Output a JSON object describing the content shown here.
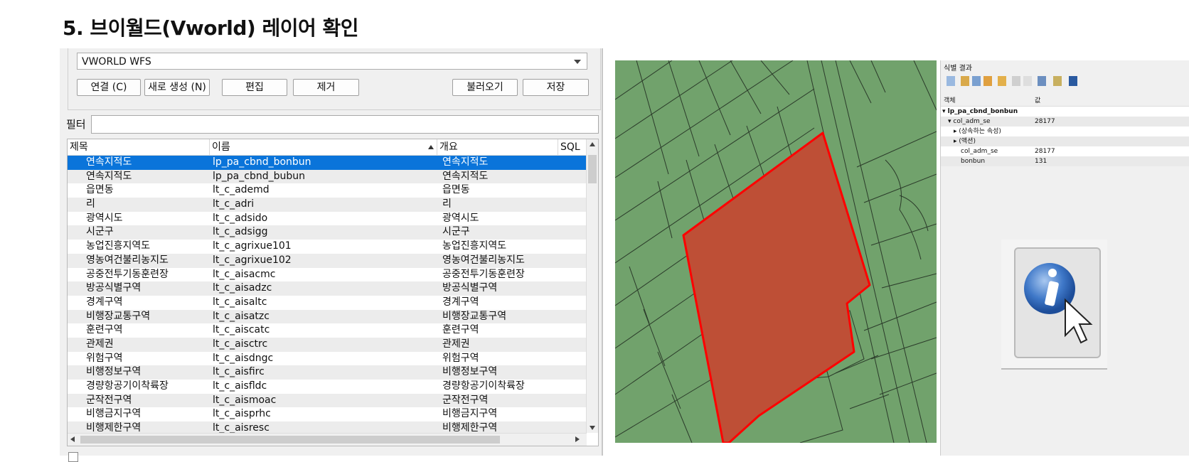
{
  "page_title": "5. 브이월드(Vworld) 레이어 확인",
  "connection": {
    "selected": "VWORLD WFS",
    "buttons": {
      "connect": "연결 (C)",
      "new": "새로 생성 (N)",
      "edit": "편집",
      "remove": "제거",
      "load": "불러오기",
      "save": "저장"
    }
  },
  "filter": {
    "label": "필터",
    "value": ""
  },
  "table": {
    "headers": [
      "제목",
      "이름",
      "개요",
      "SQL"
    ],
    "rows": [
      [
        "연속지적도",
        "lp_pa_cbnd_bonbun",
        "연속지적도"
      ],
      [
        "연속지적도",
        "lp_pa_cbnd_bubun",
        "연속지적도"
      ],
      [
        "읍면동",
        "lt_c_ademd",
        "읍면동"
      ],
      [
        "리",
        "lt_c_adri",
        "리"
      ],
      [
        "광역시도",
        "lt_c_adsido",
        "광역시도"
      ],
      [
        "시군구",
        "lt_c_adsigg",
        "시군구"
      ],
      [
        "농업진흥지역도",
        "lt_c_agrixue101",
        "농업진흥지역도"
      ],
      [
        "영농여건불리농지도",
        "lt_c_agrixue102",
        "영농여건불리농지도"
      ],
      [
        "공중전투기동훈련장",
        "lt_c_aisacmc",
        "공중전투기동훈련장"
      ],
      [
        "방공식별구역",
        "lt_c_aisadzc",
        "방공식별구역"
      ],
      [
        "경계구역",
        "lt_c_aisaltc",
        "경계구역"
      ],
      [
        "비행장교통구역",
        "lt_c_aisatzc",
        "비행장교통구역"
      ],
      [
        "훈련구역",
        "lt_c_aiscatc",
        "훈련구역"
      ],
      [
        "관제권",
        "lt_c_aisctrc",
        "관제권"
      ],
      [
        "위험구역",
        "lt_c_aisdngc",
        "위험구역"
      ],
      [
        "비행정보구역",
        "lt_c_aisfirc",
        "비행정보구역"
      ],
      [
        "경량항공기이착륙장",
        "lt_c_aisfldc",
        "경량항공기이착륙장"
      ],
      [
        "군작전구역",
        "lt_c_aismoac",
        "군작전구역"
      ],
      [
        "비행금지구역",
        "lt_c_aisprhc",
        "비행금지구역"
      ],
      [
        "비행제한구역",
        "lt_c_aisresc",
        "비행제한구역"
      ]
    ],
    "selected_row": 0
  },
  "identify": {
    "title": "식별 결과",
    "col_feature": "객체",
    "col_value": "값",
    "rows": [
      {
        "key": "▾ lp_pa_cbnd_bonbun",
        "value": ""
      },
      {
        "key": "▾ col_adm_se",
        "value": "28177"
      },
      {
        "key": "▸ (상속하는 속성)",
        "value": ""
      },
      {
        "key": "▸ (액션)",
        "value": ""
      },
      {
        "key": "col_adm_se",
        "value": "28177"
      },
      {
        "key": "bonbun",
        "value": "131"
      }
    ]
  },
  "colors": {
    "map_fill": "#71a26c",
    "parcel_fill": "#be4f36",
    "parcel_stroke": "#ff0000",
    "selection": "#0a74da"
  },
  "icons": [
    "identify-info-icon",
    "cursor-arrow-icon"
  ]
}
